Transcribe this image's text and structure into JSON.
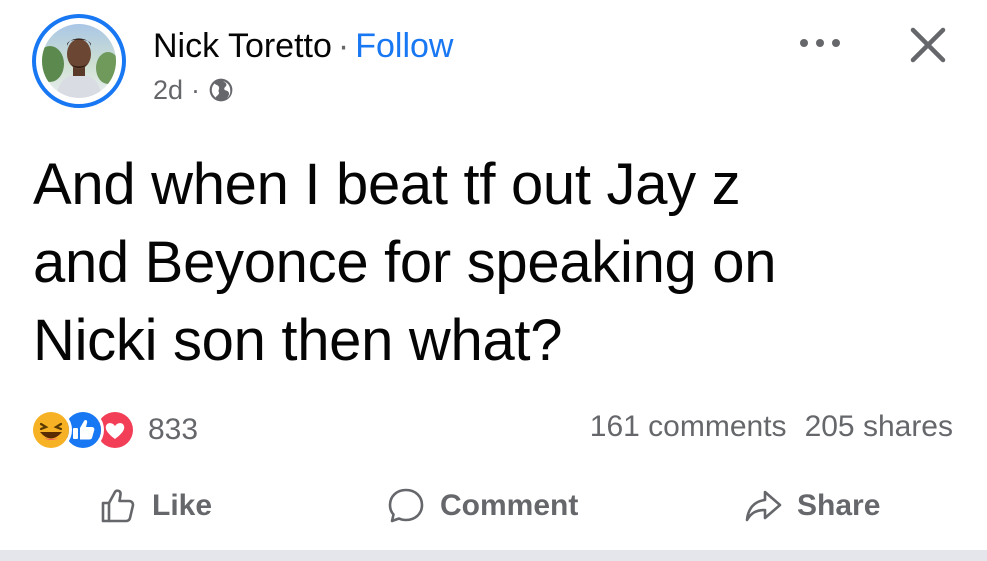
{
  "post": {
    "author": "Nick Toretto",
    "separator": "·",
    "follow_label": "Follow",
    "time": "2d",
    "meta_separator": "·",
    "audience_icon": "globe-icon",
    "more_icon": "more-horizontal-icon",
    "close_icon": "close-icon",
    "text_lines": [
      "And when I beat tf out Jay z",
      "and Beyonce for speaking on",
      "Nicki son then what?"
    ]
  },
  "stats": {
    "reactions": [
      "haha-icon",
      "like-icon",
      "love-icon"
    ],
    "reaction_count": "833",
    "comments": "161 comments",
    "shares": "205 shares"
  },
  "actions": {
    "like_label": "Like",
    "comment_label": "Comment",
    "share_label": "Share"
  },
  "colors": {
    "accent": "#1877f2",
    "secondary_text": "#65676b",
    "love": "#f33e58",
    "haha": "#f7b125"
  }
}
